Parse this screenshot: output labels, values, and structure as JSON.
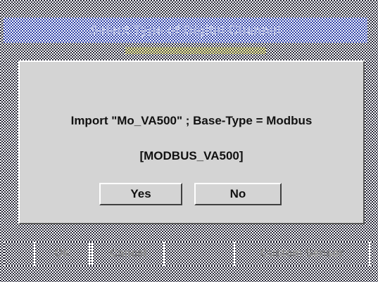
{
  "title_bar": {
    "text": "Select Type of Digital Channel"
  },
  "dialog": {
    "message": "Import \"Mo_VA500\" ; Base-Type = Modbus",
    "detail": "[MODBUS_VA500]",
    "yes_label": "Yes",
    "no_label": "No"
  },
  "bottom_bar": {
    "ok_label": "Ok",
    "cancel_label": "Cancel",
    "custom_sensor_label": "Custom Sensor"
  },
  "colors": {
    "dialog_bg": "#d4d4d4",
    "title_checker": "#2c3fa8",
    "screen_checker": "#2a2a3a",
    "highlight_strip": "#f7f3a0"
  }
}
